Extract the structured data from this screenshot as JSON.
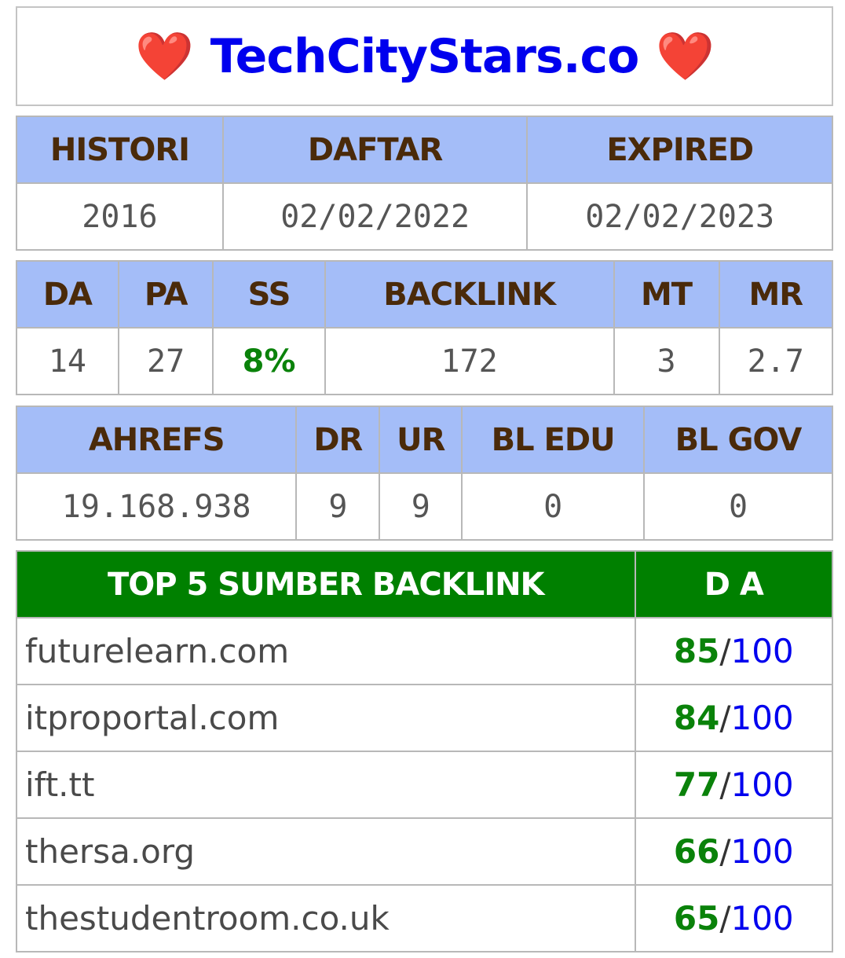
{
  "title": "TechCityStars.co",
  "heart": "❤️",
  "colors": {
    "title": "#0000ee",
    "header_bg": "#a4bdf8",
    "header_text": "#4a2a0a",
    "green": "#0a820a",
    "top_header_bg": "#008000"
  },
  "domain_info": {
    "headers": [
      "HISTORI",
      "DAFTAR",
      "EXPIRED"
    ],
    "values": [
      "2016",
      "02/02/2022",
      "02/02/2023"
    ]
  },
  "moz": {
    "headers": [
      "DA",
      "PA",
      "SS",
      "BACKLINK",
      "MT",
      "MR"
    ],
    "values": [
      "14",
      "27",
      "8%",
      "172",
      "3",
      "2.7"
    ]
  },
  "ahrefs": {
    "headers": [
      "AHREFS",
      "DR",
      "UR",
      "BL EDU",
      "BL GOV"
    ],
    "values": [
      "19.168.938",
      "9",
      "9",
      "0",
      "0"
    ]
  },
  "top_backlinks": {
    "header_source": "TOP 5 SUMBER BACKLINK",
    "header_da": "D A",
    "slash": "/",
    "max": "100",
    "rows": [
      {
        "site": "futurelearn.com",
        "da": "85"
      },
      {
        "site": "itproportal.com",
        "da": "84"
      },
      {
        "site": "ift.tt",
        "da": "77"
      },
      {
        "site": "thersa.org",
        "da": "66"
      },
      {
        "site": "thestudentroom.co.uk",
        "da": "65"
      }
    ]
  }
}
